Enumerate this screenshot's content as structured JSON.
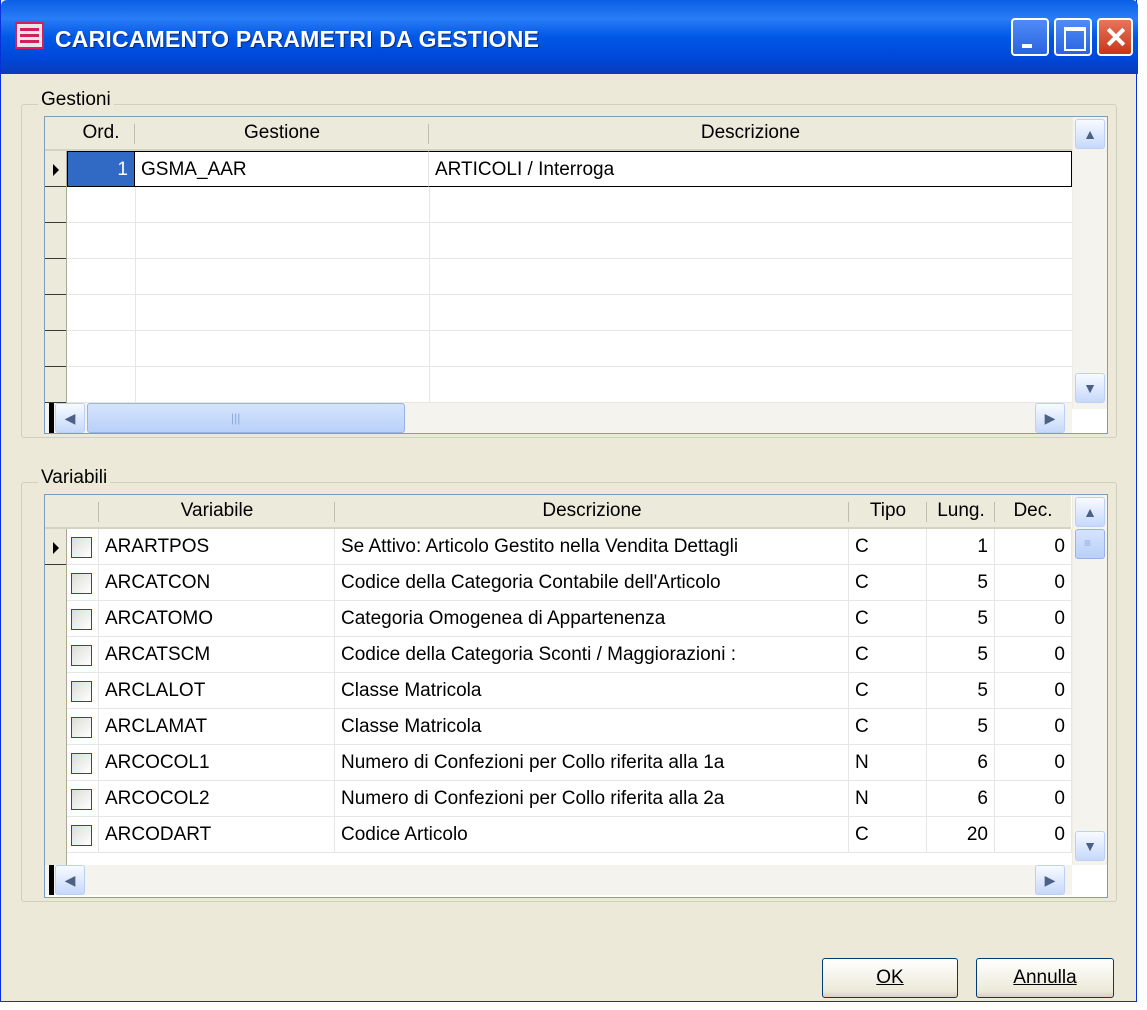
{
  "window": {
    "title": "CARICAMENTO PARAMETRI DA GESTIONE",
    "title_icon": "form-icon",
    "controls": [
      "minimize",
      "maximize",
      "close"
    ]
  },
  "gestioni": {
    "label": "Gestioni",
    "columns": [
      "Ord.",
      "Gestione",
      "Descrizione"
    ],
    "rows": [
      {
        "ord": "1",
        "gestione": "GSMA_AAR",
        "descrizione": "ARTICOLI / Interroga"
      }
    ]
  },
  "variabili": {
    "label": "Variabili",
    "columns": [
      "",
      "Variabile",
      "Descrizione",
      "Tipo",
      "Lung.",
      "Dec."
    ],
    "rows": [
      {
        "variabile": "ARARTPOS",
        "descrizione": "Se Attivo: Articolo Gestito nella Vendita Dettagli",
        "tipo": "C",
        "lung": "1",
        "dec": "0"
      },
      {
        "variabile": "ARCATCON",
        "descrizione": "Codice della Categoria Contabile dell'Articolo",
        "tipo": "C",
        "lung": "5",
        "dec": "0"
      },
      {
        "variabile": "ARCATOMO",
        "descrizione": "Categoria Omogenea di Appartenenza",
        "tipo": "C",
        "lung": "5",
        "dec": "0"
      },
      {
        "variabile": "ARCATSCM",
        "descrizione": "Codice della Categoria Sconti / Maggiorazioni :",
        "tipo": "C",
        "lung": "5",
        "dec": "0"
      },
      {
        "variabile": "ARCLALOT",
        "descrizione": "Classe Matricola",
        "tipo": "C",
        "lung": "5",
        "dec": "0"
      },
      {
        "variabile": "ARCLAMAT",
        "descrizione": "Classe Matricola",
        "tipo": "C",
        "lung": "5",
        "dec": "0"
      },
      {
        "variabile": "ARCOCOL1",
        "descrizione": "Numero di Confezioni per Collo riferita alla 1a",
        "tipo": "N",
        "lung": "6",
        "dec": "0"
      },
      {
        "variabile": "ARCOCOL2",
        "descrizione": "Numero di Confezioni per Collo riferita alla 2a",
        "tipo": "N",
        "lung": "6",
        "dec": "0"
      },
      {
        "variabile": "ARCODART",
        "descrizione": "Codice Articolo",
        "tipo": "C",
        "lung": "20",
        "dec": "0"
      }
    ]
  },
  "buttons": {
    "ok": "OK",
    "annulla": "Annulla"
  },
  "icons": {
    "scroll_up": "▲",
    "scroll_down": "▼",
    "scroll_left": "◀",
    "scroll_right": "▶"
  }
}
